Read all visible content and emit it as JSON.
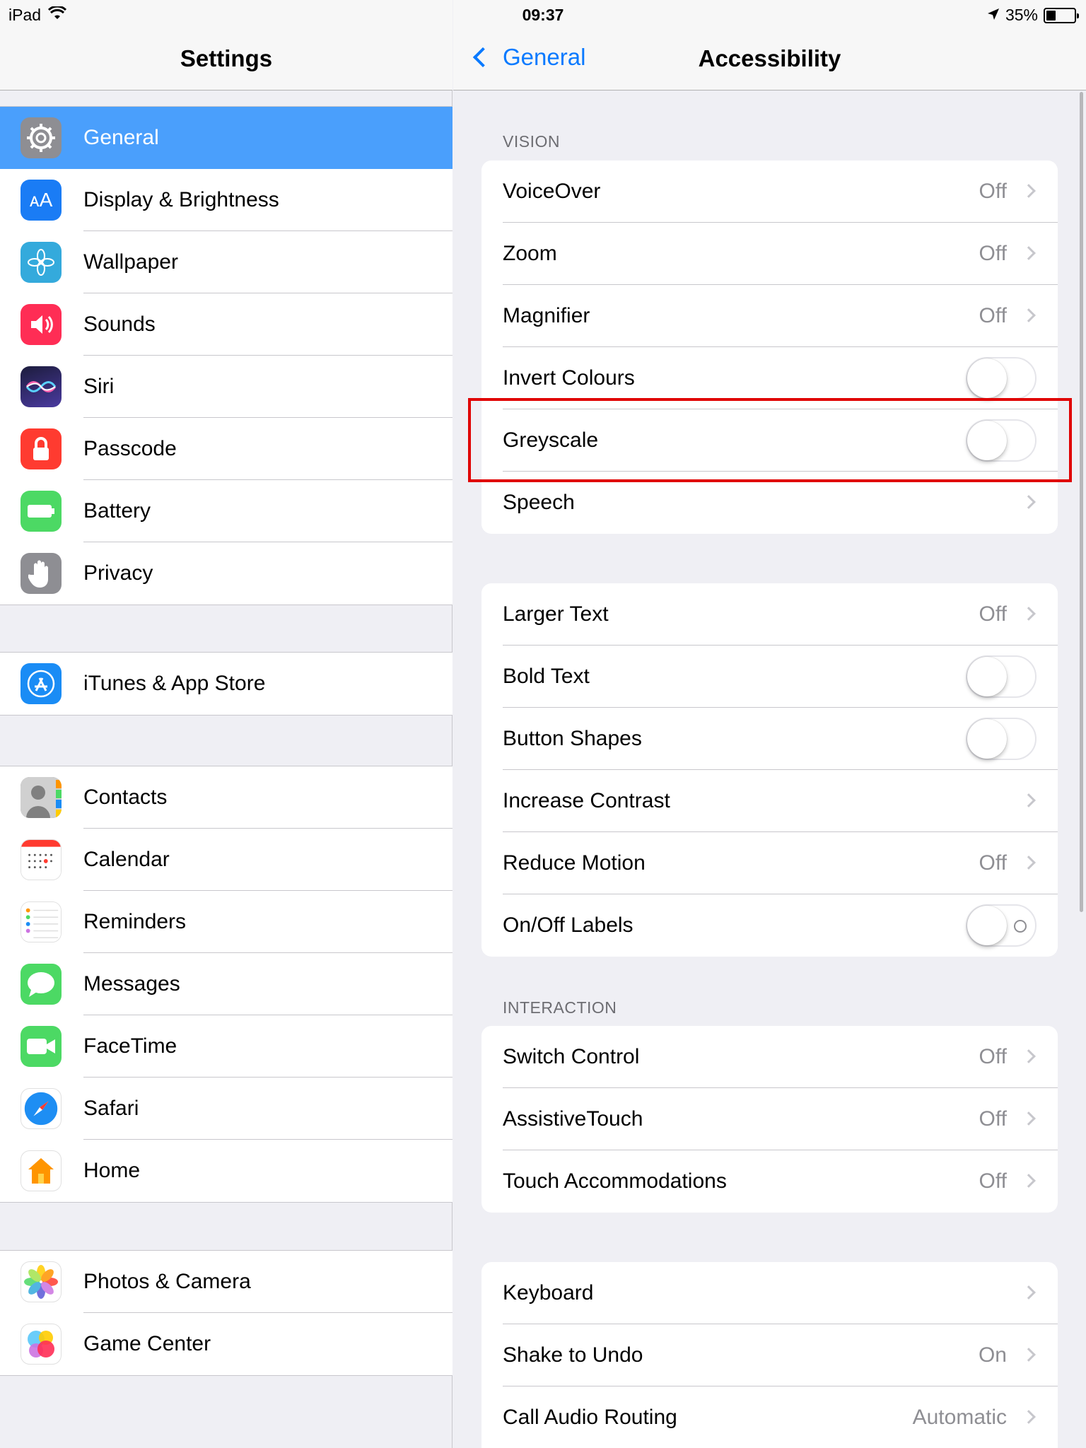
{
  "status": {
    "device": "iPad",
    "time": "09:37",
    "battery_text": "35%",
    "battery_level": 0.35
  },
  "left": {
    "title": "Settings",
    "groups": [
      [
        {
          "label": "General",
          "icon": "gear-icon",
          "color": "#8e8e93",
          "selected": true
        },
        {
          "label": "Display & Brightness",
          "icon": "text-size-icon",
          "color": "#1a7cf5"
        },
        {
          "label": "Wallpaper",
          "icon": "flower-icon",
          "color": "#34aadc"
        },
        {
          "label": "Sounds",
          "icon": "speaker-icon",
          "color": "#ff2d55"
        },
        {
          "label": "Siri",
          "icon": "siri-icon",
          "color": "#2b2d6e"
        },
        {
          "label": "Passcode",
          "icon": "lock-icon",
          "color": "#ff3b30"
        },
        {
          "label": "Battery",
          "icon": "battery-icon",
          "color": "#4cd964"
        },
        {
          "label": "Privacy",
          "icon": "hand-icon",
          "color": "#8e8e93"
        }
      ],
      [
        {
          "label": "iTunes & App Store",
          "icon": "app-store-icon",
          "color": "#1a8cf5"
        }
      ],
      [
        {
          "label": "Contacts",
          "icon": "contacts-icon",
          "color": "#9b9b9b"
        },
        {
          "label": "Calendar",
          "icon": "calendar-icon",
          "color": "#ffffff"
        },
        {
          "label": "Reminders",
          "icon": "reminders-icon",
          "color": "#ffffff"
        },
        {
          "label": "Messages",
          "icon": "speech-bubble-icon",
          "color": "#4cd964"
        },
        {
          "label": "FaceTime",
          "icon": "video-camera-icon",
          "color": "#4cd964"
        },
        {
          "label": "Safari",
          "icon": "compass-icon",
          "color": "#ffffff"
        },
        {
          "label": "Home",
          "icon": "house-icon",
          "color": "#ffffff"
        }
      ],
      [
        {
          "label": "Photos & Camera",
          "icon": "photos-icon",
          "color": "#ffffff"
        },
        {
          "label": "Game Center",
          "icon": "game-center-icon",
          "color": "#ffffff"
        }
      ]
    ]
  },
  "right": {
    "back_label": "General",
    "title": "Accessibility",
    "sections": [
      {
        "header": "VISION",
        "rows": [
          {
            "label": "VoiceOver",
            "value": "Off",
            "type": "disclosure"
          },
          {
            "label": "Zoom",
            "value": "Off",
            "type": "disclosure"
          },
          {
            "label": "Magnifier",
            "value": "Off",
            "type": "disclosure"
          },
          {
            "label": "Invert Colours",
            "type": "toggle",
            "on": false
          },
          {
            "label": "Greyscale",
            "type": "toggle",
            "on": false
          },
          {
            "label": "Speech",
            "value": "",
            "type": "disclosure"
          }
        ]
      },
      {
        "header": "",
        "rows": [
          {
            "label": "Larger Text",
            "value": "Off",
            "type": "disclosure"
          },
          {
            "label": "Bold Text",
            "type": "toggle",
            "on": false
          },
          {
            "label": "Button Shapes",
            "type": "toggle",
            "on": false
          },
          {
            "label": "Increase Contrast",
            "value": "",
            "type": "disclosure"
          },
          {
            "label": "Reduce Motion",
            "value": "Off",
            "type": "disclosure"
          },
          {
            "label": "On/Off Labels",
            "type": "toggle",
            "on": false,
            "labels": true
          }
        ]
      },
      {
        "header": "INTERACTION",
        "rows": [
          {
            "label": "Switch Control",
            "value": "Off",
            "type": "disclosure"
          },
          {
            "label": "AssistiveTouch",
            "value": "Off",
            "type": "disclosure"
          },
          {
            "label": "Touch Accommodations",
            "value": "Off",
            "type": "disclosure"
          }
        ]
      },
      {
        "header": "",
        "rows": [
          {
            "label": "Keyboard",
            "value": "",
            "type": "disclosure"
          },
          {
            "label": "Shake to Undo",
            "value": "On",
            "type": "disclosure"
          },
          {
            "label": "Call Audio Routing",
            "value": "Automatic",
            "type": "disclosure"
          }
        ]
      }
    ]
  },
  "colors": {
    "accent": "#0a7aff",
    "selection": "#4a9ffc",
    "highlight_box": "#e00000"
  }
}
